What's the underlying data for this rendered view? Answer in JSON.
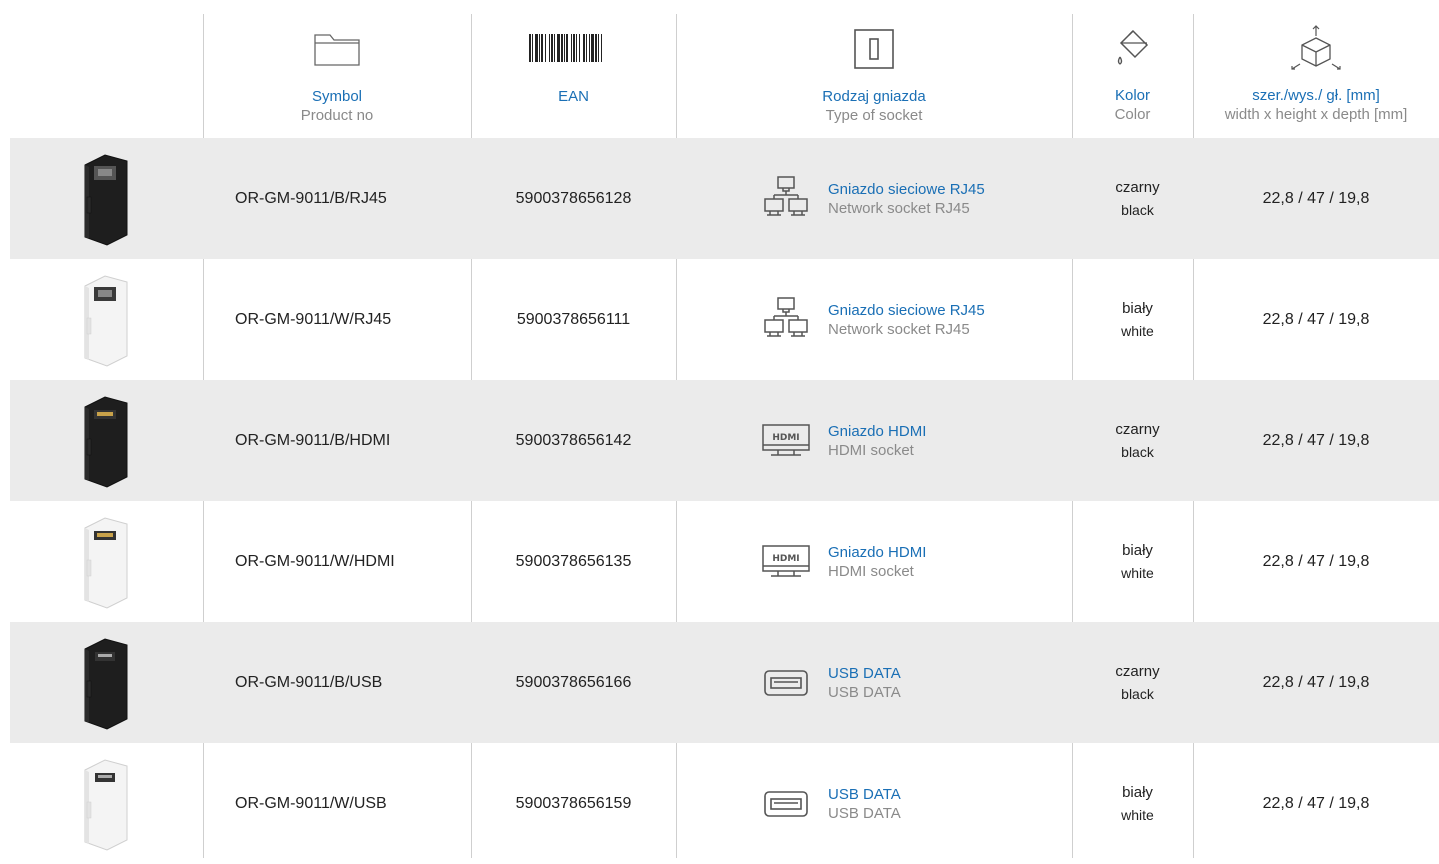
{
  "header": {
    "symbol": {
      "label": "Symbol",
      "sublabel": "Product no",
      "icon": "folder-icon"
    },
    "ean": {
      "label": "EAN",
      "icon": "barcode-icon"
    },
    "socket": {
      "label": "Rodzaj gniazda",
      "sublabel": "Type of socket",
      "icon": "socket-icon"
    },
    "color": {
      "label": "Kolor",
      "sublabel": "Color",
      "icon": "paint-bucket-icon"
    },
    "dims": {
      "label": "szer./wys./ gł. [mm]",
      "sublabel": "width x height x depth [mm]",
      "icon": "dimensions-cube-icon"
    }
  },
  "rows": [
    {
      "product_color": "black",
      "socket_type": "rj45",
      "symbol": "OR-GM-9011/B/RJ45",
      "ean": "5900378656128",
      "socket_pl": "Gniazdo sieciowe RJ45",
      "socket_en": "Network socket RJ45",
      "color_pl": "czarny",
      "color_en": "black",
      "dims": "22,8 / 47 / 19,8"
    },
    {
      "product_color": "white",
      "socket_type": "rj45",
      "symbol": "OR-GM-9011/W/RJ45",
      "ean": "5900378656111",
      "socket_pl": "Gniazdo sieciowe RJ45",
      "socket_en": "Network socket RJ45",
      "color_pl": "biały",
      "color_en": "white",
      "dims": "22,8 / 47 / 19,8"
    },
    {
      "product_color": "black",
      "socket_type": "hdmi",
      "symbol": "OR-GM-9011/B/HDMI",
      "ean": "5900378656142",
      "socket_pl": "Gniazdo HDMI",
      "socket_en": "HDMI socket",
      "color_pl": "czarny",
      "color_en": "black",
      "dims": "22,8 / 47 / 19,8"
    },
    {
      "product_color": "white",
      "socket_type": "hdmi",
      "symbol": "OR-GM-9011/W/HDMI",
      "ean": "5900378656135",
      "socket_pl": "Gniazdo HDMI",
      "socket_en": "HDMI socket",
      "color_pl": "biały",
      "color_en": "white",
      "dims": "22,8 / 47 / 19,8"
    },
    {
      "product_color": "black",
      "socket_type": "usb",
      "symbol": "OR-GM-9011/B/USB",
      "ean": "5900378656166",
      "socket_pl": "USB DATA",
      "socket_en": "USB DATA",
      "color_pl": "czarny",
      "color_en": "black",
      "dims": "22,8 / 47 / 19,8"
    },
    {
      "product_color": "white",
      "socket_type": "usb",
      "symbol": "OR-GM-9011/W/USB",
      "ean": "5900378656159",
      "socket_pl": "USB DATA",
      "socket_en": "USB DATA",
      "color_pl": "biały",
      "color_en": "white",
      "dims": "22,8 / 47 / 19,8"
    }
  ],
  "colors": {
    "accent": "#1a6fb5",
    "muted": "#8a8a8a",
    "row_shade": "#ebebeb",
    "divider": "#cfcfcf"
  }
}
